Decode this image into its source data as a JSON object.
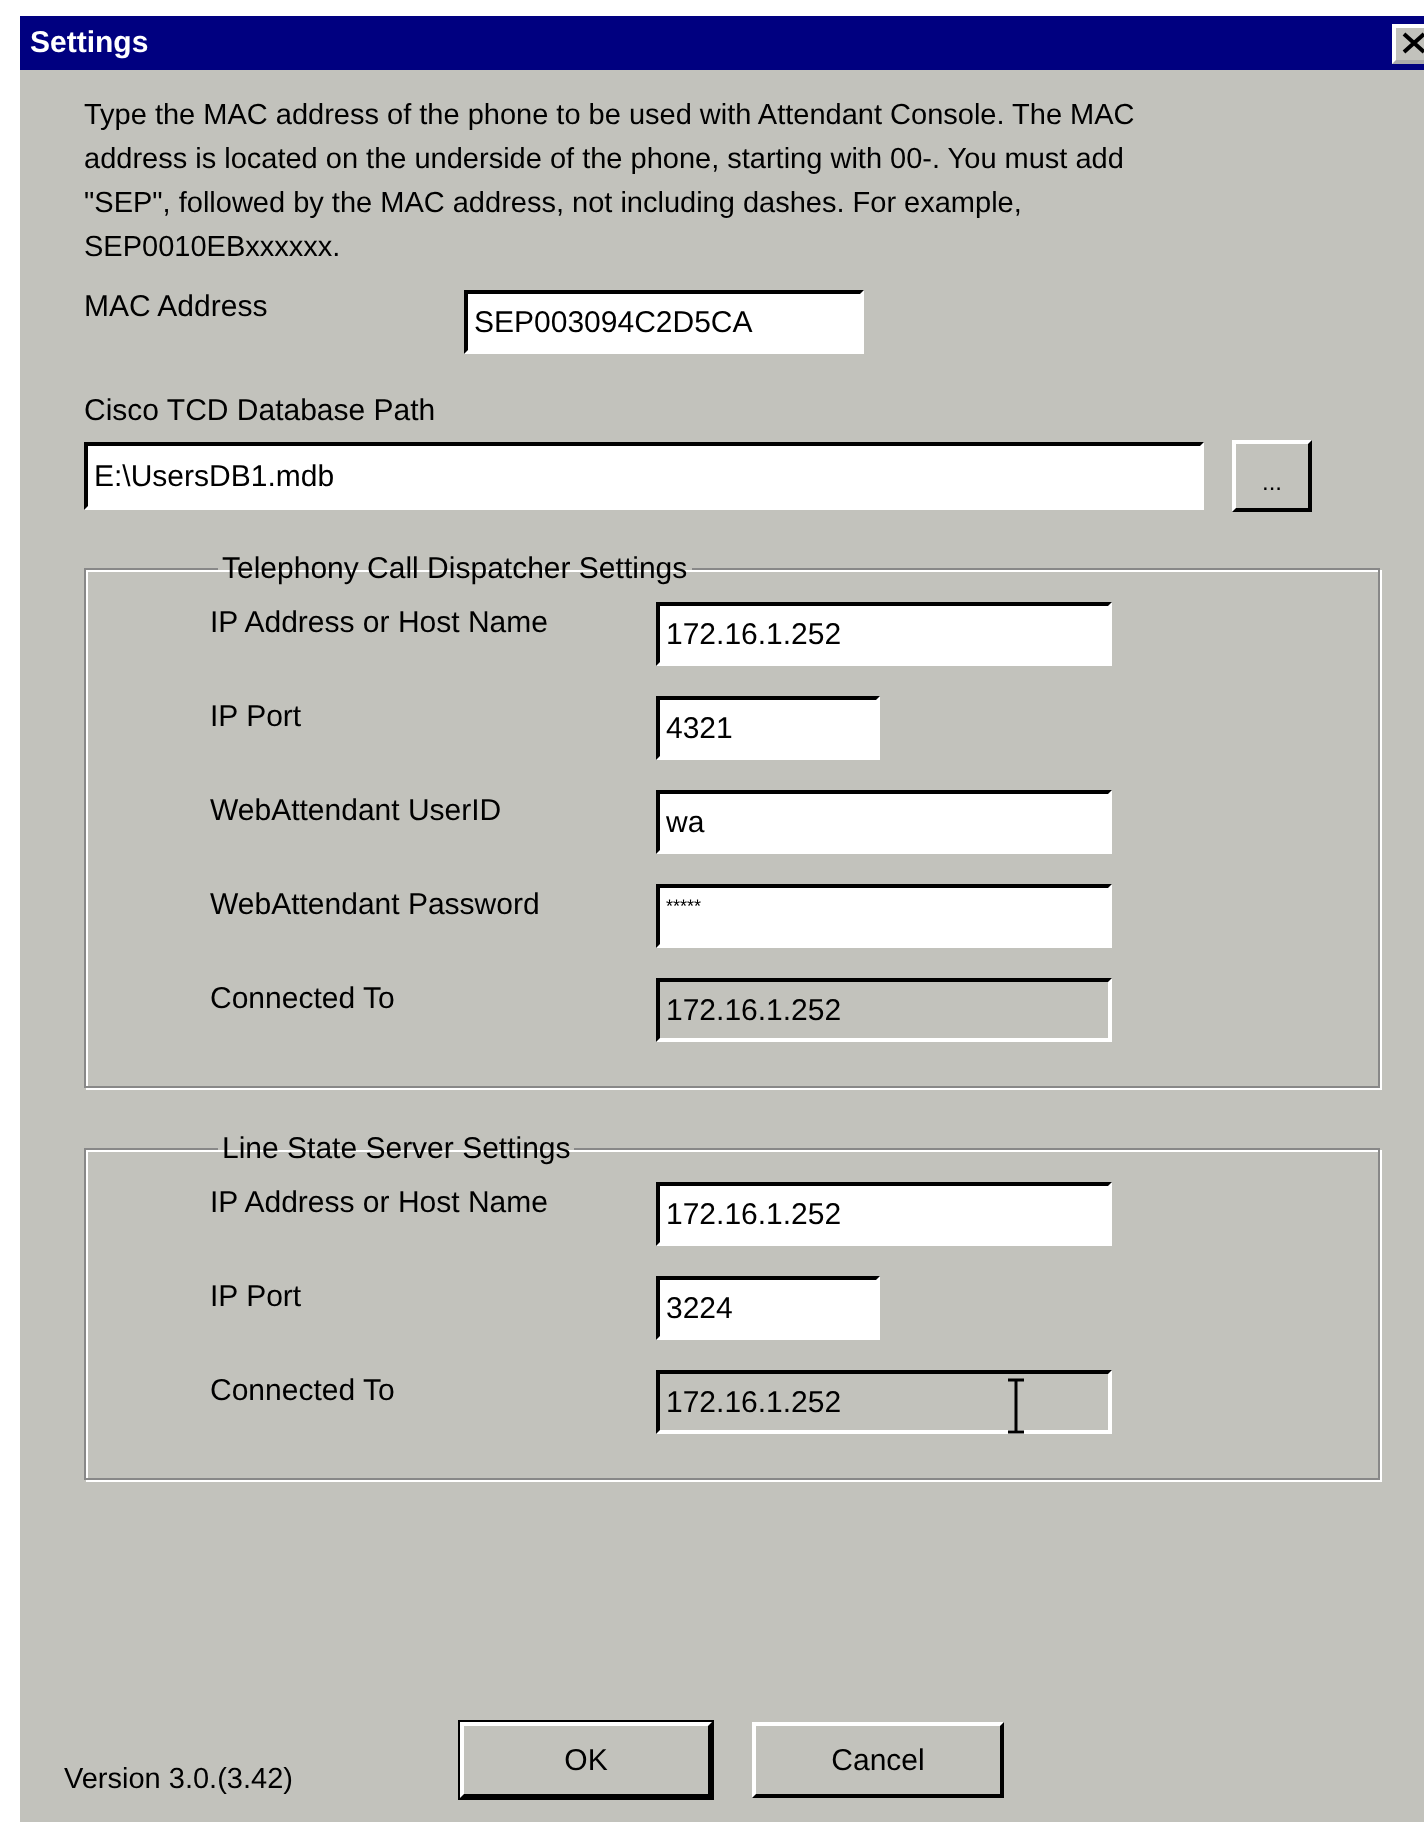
{
  "window": {
    "title": "Settings"
  },
  "description": "Type the MAC address of the phone to be used with Attendant Console. The MAC address is located on the underside of the phone, starting with 00-. You must add  \"SEP\", followed by the MAC address, not including dashes. For example, SEP0010EBxxxxxx.",
  "mac_address": {
    "label": "MAC Address",
    "value": "SEP003094C2D5CA"
  },
  "database_path": {
    "label": "Cisco TCD Database Path",
    "value": "E:\\UsersDB1.mdb",
    "browse_button": "..."
  },
  "groups": [
    {
      "title": "Telephony Call Dispatcher Settings",
      "fields": [
        {
          "label": "IP Address or Host Name",
          "value": "172.16.1.252",
          "kind": "text",
          "disabled": false
        },
        {
          "label": "IP Port",
          "value": "4321",
          "kind": "port",
          "disabled": false
        },
        {
          "label": "WebAttendant UserID",
          "value": "wa",
          "kind": "text",
          "disabled": false
        },
        {
          "label": "WebAttendant Password",
          "value": "*****",
          "kind": "password",
          "disabled": false
        },
        {
          "label": "Connected To",
          "value": "172.16.1.252",
          "kind": "text",
          "disabled": true
        }
      ]
    },
    {
      "title": "Line State Server Settings",
      "fields": [
        {
          "label": "IP Address or Host Name",
          "value": "172.16.1.252",
          "kind": "text",
          "disabled": false
        },
        {
          "label": "IP Port",
          "value": "3224",
          "kind": "port",
          "disabled": false
        },
        {
          "label": "Connected To",
          "value": "172.16.1.252",
          "kind": "text",
          "disabled": true
        }
      ]
    }
  ],
  "version": "Version 3.0.(3.42)",
  "buttons": [
    {
      "label": "OK",
      "default": true
    },
    {
      "label": "Cancel",
      "default": false
    }
  ]
}
